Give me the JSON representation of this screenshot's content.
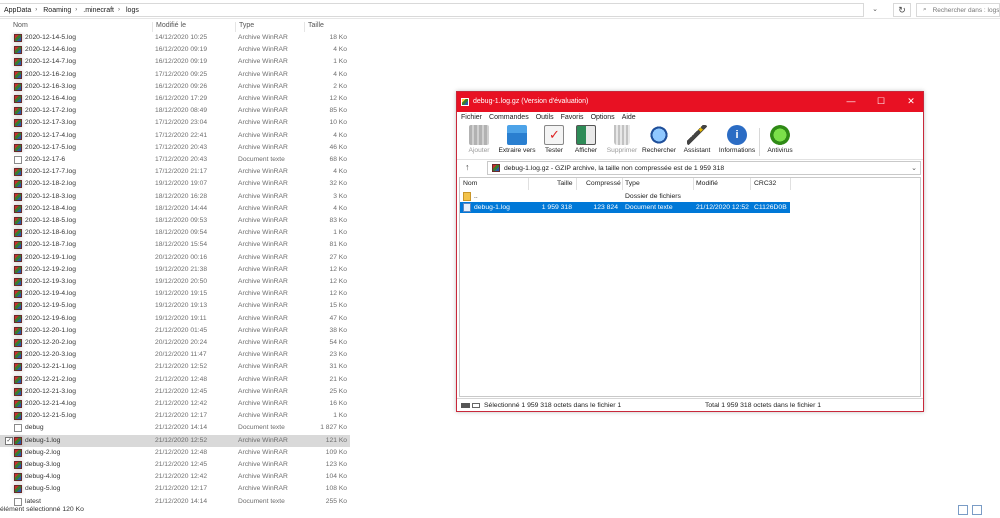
{
  "explorer": {
    "breadcrumbs": [
      "AppData",
      "Roaming",
      ".minecraft",
      "logs"
    ],
    "search_placeholder": "Rechercher dans : logs",
    "columns": [
      "Nom",
      "Modifié le",
      "Type",
      "Taille"
    ],
    "files": [
      {
        "name": "2020-12-14-5.log",
        "date": "14/12/2020 10:25",
        "type": "Archive WinRAR",
        "size": "18 Ko",
        "icon": "rar-archive-icon"
      },
      {
        "name": "2020-12-14-6.log",
        "date": "16/12/2020 09:19",
        "type": "Archive WinRAR",
        "size": "4 Ko",
        "icon": "rar-archive-icon"
      },
      {
        "name": "2020-12-14-7.log",
        "date": "16/12/2020 09:19",
        "type": "Archive WinRAR",
        "size": "1 Ko",
        "icon": "rar-archive-icon"
      },
      {
        "name": "2020-12-16-2.log",
        "date": "17/12/2020 09:25",
        "type": "Archive WinRAR",
        "size": "4 Ko",
        "icon": "rar-archive-icon"
      },
      {
        "name": "2020-12-16-3.log",
        "date": "16/12/2020 09:26",
        "type": "Archive WinRAR",
        "size": "2 Ko",
        "icon": "rar-archive-icon"
      },
      {
        "name": "2020-12-16-4.log",
        "date": "16/12/2020 17:29",
        "type": "Archive WinRAR",
        "size": "12 Ko",
        "icon": "rar-archive-icon"
      },
      {
        "name": "2020-12-17-2.log",
        "date": "18/12/2020 08:49",
        "type": "Archive WinRAR",
        "size": "85 Ko",
        "icon": "rar-archive-icon"
      },
      {
        "name": "2020-12-17-3.log",
        "date": "17/12/2020 23:04",
        "type": "Archive WinRAR",
        "size": "10 Ko",
        "icon": "rar-archive-icon"
      },
      {
        "name": "2020-12-17-4.log",
        "date": "17/12/2020 22:41",
        "type": "Archive WinRAR",
        "size": "4 Ko",
        "icon": "rar-archive-icon"
      },
      {
        "name": "2020-12-17-5.log",
        "date": "17/12/2020 20:43",
        "type": "Archive WinRAR",
        "size": "46 Ko",
        "icon": "rar-archive-icon"
      },
      {
        "name": "2020-12-17-6",
        "date": "17/12/2020 20:43",
        "type": "Document texte",
        "size": "68 Ko",
        "icon": "text-document-icon"
      },
      {
        "name": "2020-12-17-7.log",
        "date": "17/12/2020 21:17",
        "type": "Archive WinRAR",
        "size": "4 Ko",
        "icon": "rar-archive-icon"
      },
      {
        "name": "2020-12-18-2.log",
        "date": "19/12/2020 19:07",
        "type": "Archive WinRAR",
        "size": "32 Ko",
        "icon": "rar-archive-icon"
      },
      {
        "name": "2020-12-18-3.log",
        "date": "18/12/2020 16:28",
        "type": "Archive WinRAR",
        "size": "3 Ko",
        "icon": "rar-archive-icon"
      },
      {
        "name": "2020-12-18-4.log",
        "date": "18/12/2020 14:44",
        "type": "Archive WinRAR",
        "size": "4 Ko",
        "icon": "rar-archive-icon"
      },
      {
        "name": "2020-12-18-5.log",
        "date": "18/12/2020 09:53",
        "type": "Archive WinRAR",
        "size": "83 Ko",
        "icon": "rar-archive-icon"
      },
      {
        "name": "2020-12-18-6.log",
        "date": "18/12/2020 09:54",
        "type": "Archive WinRAR",
        "size": "1 Ko",
        "icon": "rar-archive-icon"
      },
      {
        "name": "2020-12-18-7.log",
        "date": "18/12/2020 15:54",
        "type": "Archive WinRAR",
        "size": "81 Ko",
        "icon": "rar-archive-icon"
      },
      {
        "name": "2020-12-19-1.log",
        "date": "20/12/2020 00:16",
        "type": "Archive WinRAR",
        "size": "27 Ko",
        "icon": "rar-archive-icon"
      },
      {
        "name": "2020-12-19-2.log",
        "date": "19/12/2020 21:38",
        "type": "Archive WinRAR",
        "size": "12 Ko",
        "icon": "rar-archive-icon"
      },
      {
        "name": "2020-12-19-3.log",
        "date": "19/12/2020 20:50",
        "type": "Archive WinRAR",
        "size": "12 Ko",
        "icon": "rar-archive-icon"
      },
      {
        "name": "2020-12-19-4.log",
        "date": "19/12/2020 19:15",
        "type": "Archive WinRAR",
        "size": "12 Ko",
        "icon": "rar-archive-icon"
      },
      {
        "name": "2020-12-19-5.log",
        "date": "19/12/2020 19:13",
        "type": "Archive WinRAR",
        "size": "15 Ko",
        "icon": "rar-archive-icon"
      },
      {
        "name": "2020-12-19-6.log",
        "date": "19/12/2020 19:11",
        "type": "Archive WinRAR",
        "size": "47 Ko",
        "icon": "rar-archive-icon"
      },
      {
        "name": "2020-12-20-1.log",
        "date": "21/12/2020 01:45",
        "type": "Archive WinRAR",
        "size": "38 Ko",
        "icon": "rar-archive-icon"
      },
      {
        "name": "2020-12-20-2.log",
        "date": "20/12/2020 20:24",
        "type": "Archive WinRAR",
        "size": "54 Ko",
        "icon": "rar-archive-icon"
      },
      {
        "name": "2020-12-20-3.log",
        "date": "20/12/2020 11:47",
        "type": "Archive WinRAR",
        "size": "23 Ko",
        "icon": "rar-archive-icon"
      },
      {
        "name": "2020-12-21-1.log",
        "date": "21/12/2020 12:52",
        "type": "Archive WinRAR",
        "size": "31 Ko",
        "icon": "rar-archive-icon"
      },
      {
        "name": "2020-12-21-2.log",
        "date": "21/12/2020 12:48",
        "type": "Archive WinRAR",
        "size": "21 Ko",
        "icon": "rar-archive-icon"
      },
      {
        "name": "2020-12-21-3.log",
        "date": "21/12/2020 12:45",
        "type": "Archive WinRAR",
        "size": "25 Ko",
        "icon": "rar-archive-icon"
      },
      {
        "name": "2020-12-21-4.log",
        "date": "21/12/2020 12:42",
        "type": "Archive WinRAR",
        "size": "16 Ko",
        "icon": "rar-archive-icon"
      },
      {
        "name": "2020-12-21-5.log",
        "date": "21/12/2020 12:17",
        "type": "Archive WinRAR",
        "size": "1 Ko",
        "icon": "rar-archive-icon"
      },
      {
        "name": "debug",
        "date": "21/12/2020 14:14",
        "type": "Document texte",
        "size": "1 827 Ko",
        "icon": "text-document-icon"
      },
      {
        "name": "debug-1.log",
        "date": "21/12/2020 12:52",
        "type": "Archive WinRAR",
        "size": "121 Ko",
        "icon": "rar-archive-icon",
        "selected": true
      },
      {
        "name": "debug-2.log",
        "date": "21/12/2020 12:48",
        "type": "Archive WinRAR",
        "size": "109 Ko",
        "icon": "rar-archive-icon"
      },
      {
        "name": "debug-3.log",
        "date": "21/12/2020 12:45",
        "type": "Archive WinRAR",
        "size": "123 Ko",
        "icon": "rar-archive-icon"
      },
      {
        "name": "debug-4.log",
        "date": "21/12/2020 12:42",
        "type": "Archive WinRAR",
        "size": "104 Ko",
        "icon": "rar-archive-icon"
      },
      {
        "name": "debug-5.log",
        "date": "21/12/2020 12:17",
        "type": "Archive WinRAR",
        "size": "108 Ko",
        "icon": "rar-archive-icon"
      },
      {
        "name": "latest",
        "date": "21/12/2020 14:14",
        "type": "Document texte",
        "size": "255 Ko",
        "icon": "text-document-icon"
      }
    ],
    "status": "élément sélectionné  120 Ko"
  },
  "winrar": {
    "title": "debug-1.log.gz (Version d'évaluation)",
    "menu": [
      "Fichier",
      "Commandes",
      "Outils",
      "Favoris",
      "Options",
      "Aide"
    ],
    "toolbar": [
      {
        "label": "Ajouter",
        "icon": "add-archive-icon",
        "disabled": true
      },
      {
        "label": "Extraire vers",
        "icon": "extract-folder-icon",
        "disabled": false
      },
      {
        "label": "Tester",
        "icon": "test-archive-icon",
        "disabled": false
      },
      {
        "label": "Afficher",
        "icon": "view-book-icon",
        "disabled": false
      },
      {
        "label": "Supprimer",
        "icon": "delete-trash-icon",
        "disabled": true
      },
      {
        "label": "Rechercher",
        "icon": "find-magnifier-icon",
        "disabled": false
      },
      {
        "label": "Assistant",
        "icon": "wizard-wand-icon",
        "disabled": false
      },
      {
        "label": "Informations",
        "icon": "info-icon",
        "disabled": false
      },
      {
        "label": "Antivirus",
        "icon": "antivirus-icon",
        "disabled": false
      }
    ],
    "path": "debug-1.log.gz - GZIP archive, la taille non compressée est de 1 959 318",
    "columns": [
      "Nom",
      "Taille",
      "Compressé",
      "Type",
      "Modifié",
      "CRC32"
    ],
    "rows": [
      {
        "name": "..",
        "size": "",
        "packed": "",
        "type": "Dossier de fichiers",
        "modified": "",
        "crc": "",
        "icon": "folder-up-icon",
        "selected": false
      },
      {
        "name": "debug-1.log",
        "size": "1 959 318",
        "packed": "123 824",
        "type": "Document texte",
        "modified": "21/12/2020 12:52",
        "crc": "C1126D0B",
        "icon": "log-document-icon",
        "selected": true
      }
    ],
    "status_left": "Sélectionné 1 959 318 octets dans le fichier 1",
    "status_right": "Total 1 959 318 octets dans le fichier 1"
  }
}
